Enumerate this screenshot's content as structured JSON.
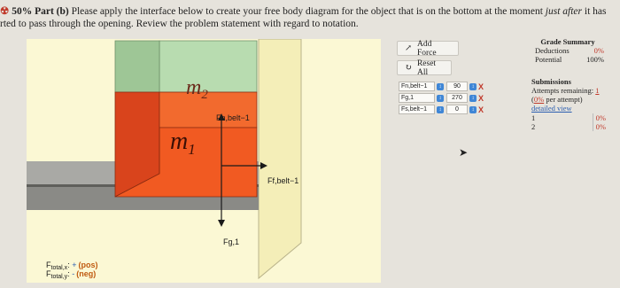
{
  "header": {
    "line1_percent": "50%",
    "line1_part": "Part (b)",
    "line1_text": " Please apply the interface below to create your free body diagram for the object that is on the bottom at the moment ",
    "line1_italic": "just after",
    "line1_tail": " it has",
    "line2": "rted to pass through the opening. Review the problem statement with regard to notation."
  },
  "figure": {
    "mass_top": "m",
    "mass_top_sub": "2",
    "mass_bottom": "m",
    "mass_bottom_sub": "1",
    "force_normal_label": "Fn,belt−1",
    "force_gravity_label": "Fg,1",
    "force_friction_label": "Ff,belt−1",
    "sum_x_label": "F",
    "sum_x_sub": "total,x",
    "sum_x_value": "(pos)",
    "sum_y_label": "F",
    "sum_y_sub": "total,y",
    "sum_y_value": "(neg)"
  },
  "controls": {
    "add_force": "Add Force",
    "reset_all": "Reset All",
    "forces": [
      {
        "name": "Fn,belt−1",
        "angle": "90"
      },
      {
        "name": "Fg,1",
        "angle": "270"
      },
      {
        "name": "Fs,belt−1",
        "angle": "0"
      }
    ],
    "remove_symbol": "X"
  },
  "grade_summary": {
    "title": "Grade Summary",
    "deductions_label": "Deductions",
    "deductions_value": "0%",
    "potential_label": "Potential",
    "potential_value": "100%"
  },
  "submissions": {
    "title": "Submissions",
    "attempts_label": "Attempts remaining: ",
    "attempts_value": "1",
    "per_attempt_open": "(",
    "per_attempt_value": "0%",
    "per_attempt_close": " per attempt)",
    "detailed_view": "detailed view",
    "rows": [
      {
        "num": "1",
        "score": "0%"
      },
      {
        "num": "2",
        "score": "0%"
      }
    ]
  },
  "colors": {
    "belt": "#8c8c88",
    "box_front": "#f15a22",
    "box_side": "#d9421a",
    "upper_block": "#a6cfa0",
    "arrow": "#1a1a1a"
  }
}
